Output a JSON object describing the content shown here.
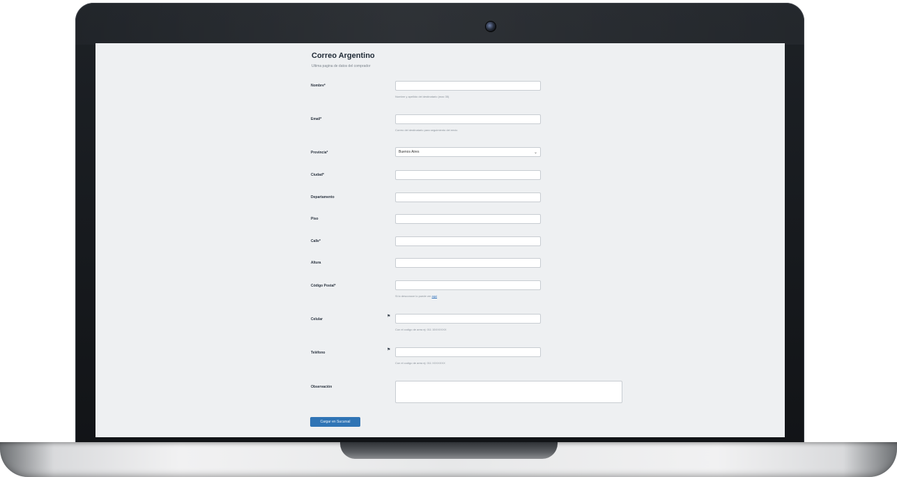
{
  "form": {
    "title": "Correo Argentino",
    "subtitle": "Ultima pagina de datos del comprador",
    "submit_label": "Cargar en Sucursal"
  },
  "fields": {
    "nombre": {
      "label": "Nombre*",
      "value": "",
      "help": "Nombre y apellido del destinatario (max 35)"
    },
    "email": {
      "label": "Email*",
      "value": "",
      "help": "Correo del destinatario para seguimiento del envio"
    },
    "provincia": {
      "label": "Provincia*",
      "value": "Buenos Aires"
    },
    "ciudad": {
      "label": "Ciudad*",
      "value": ""
    },
    "departamento": {
      "label": "Departamento",
      "value": ""
    },
    "piso": {
      "label": "Piso",
      "value": ""
    },
    "calle": {
      "label": "Calle*",
      "value": ""
    },
    "altura": {
      "label": "Altura",
      "value": ""
    },
    "codigo_postal": {
      "label": "Código Postal*",
      "value": "",
      "help": "Si lo desconoce lo puede ver",
      "help_link": "aqui"
    },
    "celular": {
      "label": "Celular",
      "value": "",
      "help": "Con el codigo de area ej: 011 15XXXXXX"
    },
    "telefono": {
      "label": "Teléfono",
      "value": "",
      "help": "Con el codigo de area ej: 011 XXXXXXX"
    },
    "observaciones": {
      "label": "Observación",
      "value": ""
    }
  },
  "colors": {
    "accent": "#2f74b5",
    "background": "#eef0f2"
  },
  "icons": {
    "select_chevron": "chevron-down-icon",
    "flag": "flag-icon"
  }
}
